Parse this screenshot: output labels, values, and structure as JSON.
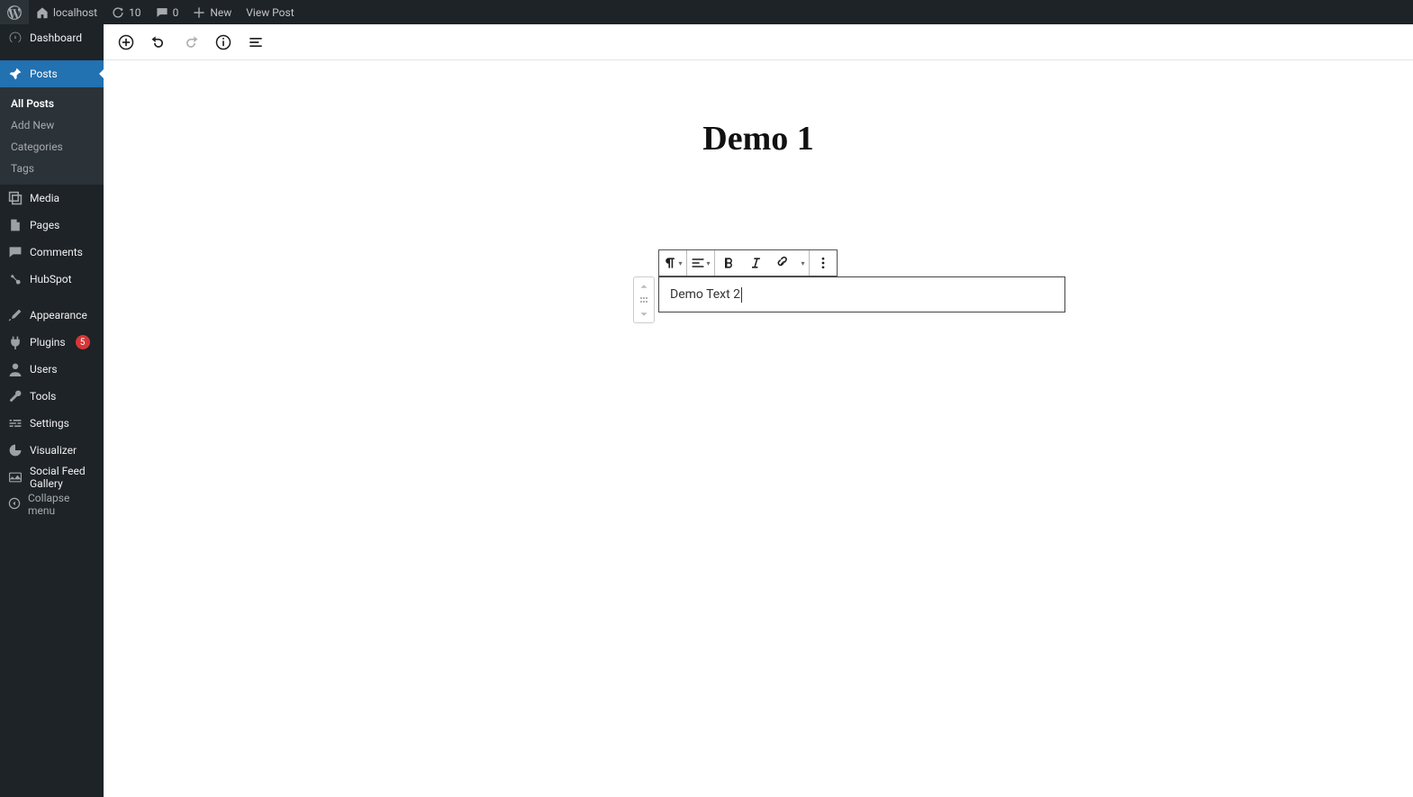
{
  "adminbar": {
    "site_name": "localhost",
    "updates": "10",
    "comments": "0",
    "new": "New",
    "view_post": "View Post"
  },
  "sidebar": {
    "dashboard": "Dashboard",
    "posts": "Posts",
    "posts_sub": [
      "All Posts",
      "Add New",
      "Categories",
      "Tags"
    ],
    "media": "Media",
    "pages": "Pages",
    "comments": "Comments",
    "hubspot": "HubSpot",
    "appearance": "Appearance",
    "plugins": "Plugins",
    "plugins_badge": "5",
    "users": "Users",
    "tools": "Tools",
    "settings": "Settings",
    "visualizer": "Visualizer",
    "social_feed": "Social Feed Gallery",
    "collapse": "Collapse menu"
  },
  "editor": {
    "post_title": "Demo 1",
    "block_text": "Demo Text 2"
  }
}
